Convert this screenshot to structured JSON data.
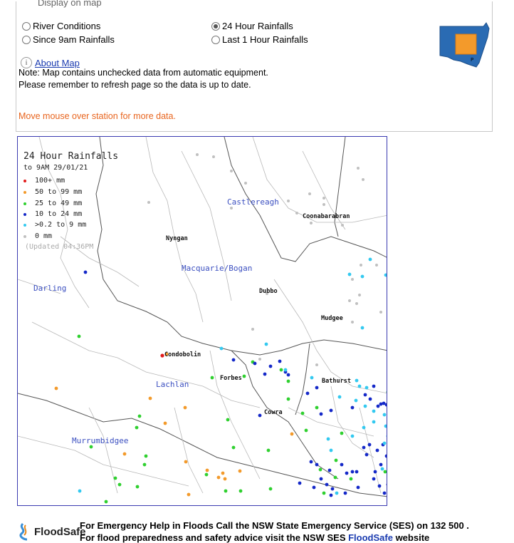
{
  "panel": {
    "legend": "Display on map",
    "options": [
      {
        "label": "River Conditions",
        "selected": false
      },
      {
        "label": "24 Hour Rainfalls",
        "selected": true
      },
      {
        "label": "Since 9am Rainfalls",
        "selected": false
      },
      {
        "label": "Last 1 Hour Rainfalls",
        "selected": false
      }
    ],
    "about_link": "About Map",
    "note_line1": "Note: Map contains unchecked data from automatic equipment.",
    "note_line2": "Please remember to refresh page so the data is up to date.",
    "hover_message": "Move mouse over station for more data."
  },
  "map": {
    "title": "24 Hour Rainfalls",
    "subtitle": "to 9AM 29/01/21",
    "legend": [
      {
        "label": "100+ mm",
        "color": "#e21b1b"
      },
      {
        "label": "50  to 99 mm",
        "color": "#f39a2b"
      },
      {
        "label": "25  to 49 mm",
        "color": "#2fd02f"
      },
      {
        "label": "10  to 24 mm",
        "color": "#1428c8"
      },
      {
        "label": ">0.2 to 9 mm",
        "color": "#33c9f0"
      },
      {
        "label": "0 mm",
        "color": "#c0c0c0"
      }
    ],
    "updated": "(Updated 04:36PM",
    "catchments": {
      "castlereagh": "Castlereagh",
      "macquarie": "Macquarie/Bogan",
      "darling": "Darling",
      "lachlan": "Lachlan",
      "murrumbidgee": "Murrumbidgee"
    },
    "towns": {
      "coonabarabran": "Coonabarabran",
      "nyngan": "Nyngan",
      "dubbo": "Dubbo",
      "mudgee": "Mudgee",
      "condobolin": "Condobolin",
      "forbes": "Forbes",
      "bathurst": "Bathurst",
      "cowra": "Cowra"
    }
  },
  "footer": {
    "logo": "FloodSafe",
    "line1": "For Emergency Help in Floods Call the NSW State Emergency Service (SES) on 132 500 .",
    "line2_prefix": "For flood preparedness and safety advice visit the NSW SES ",
    "line2_link": "FloodSafe",
    "line2_suffix": " website"
  }
}
